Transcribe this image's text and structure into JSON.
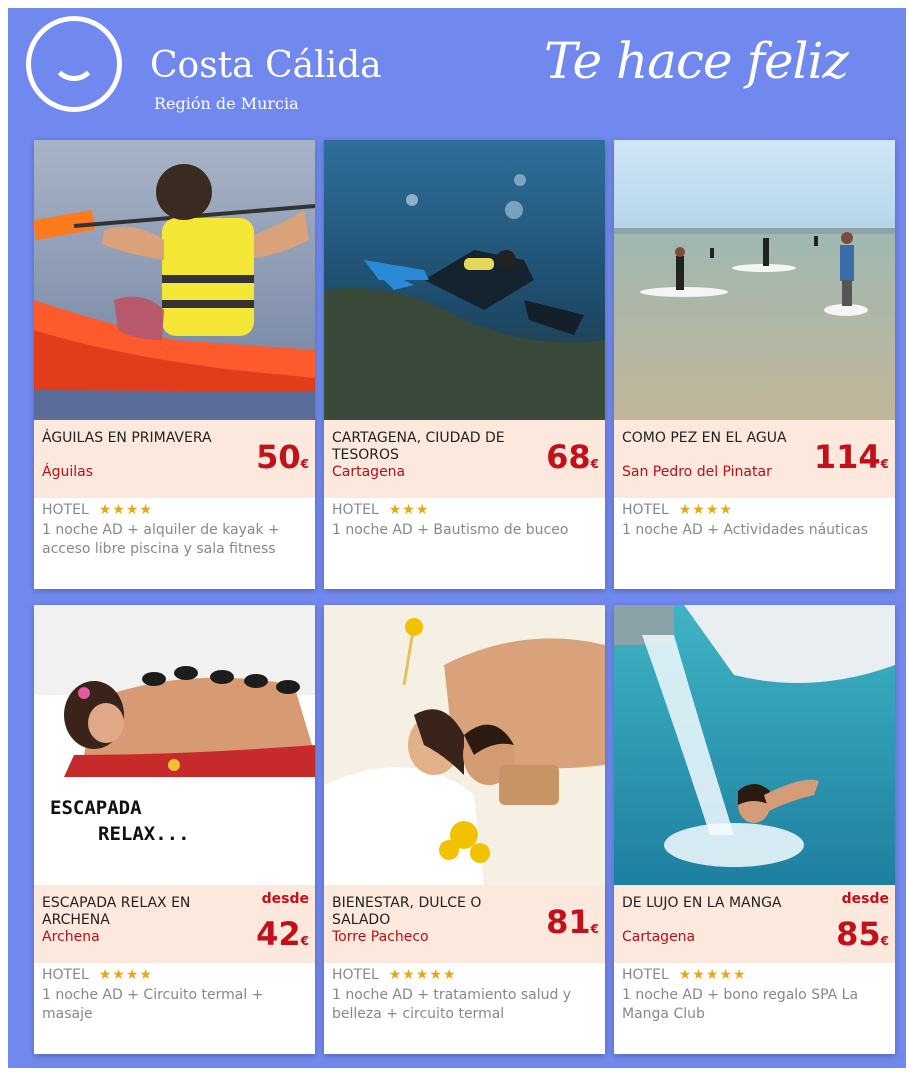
{
  "header": {
    "brand_title": "Costa Cálida",
    "brand_subtitle": "Región de Murcia",
    "slogan": "Te hace feliz"
  },
  "colors": {
    "background": "#7189ee",
    "price": "#c1121b",
    "info_bg": "#fce8dc",
    "star": "#e6a817"
  },
  "offers": [
    {
      "title": "ÁGUILAS EN PRIMAVERA",
      "city": "Águilas",
      "price": "50",
      "currency": "€",
      "desde": "",
      "hotel": "HOTEL",
      "stars": "★★★★",
      "description": "1 noche AD + alquiler de kayak + acceso libre piscina y sala fitness",
      "image": "kayak-photo"
    },
    {
      "title": "CARTAGENA, CIUDAD DE TESOROS",
      "city": "Cartagena",
      "price": "68",
      "currency": "€",
      "desde": "",
      "hotel": "HOTEL",
      "stars": "★★★",
      "description": "1 noche AD + Bautismo de buceo",
      "image": "diving-photo"
    },
    {
      "title": "COMO PEZ EN EL AGUA",
      "city": "San Pedro del Pinatar",
      "price": "114",
      "currency": "€",
      "desde": "",
      "hotel": "HOTEL",
      "stars": "★★★★",
      "description": "1 noche AD + Actividades náuticas",
      "image": "paddle-surf-photo"
    },
    {
      "title": "ESCAPADA RELAX EN ARCHENA",
      "city": "Archena",
      "price": "42",
      "currency": "€",
      "desde": "desde",
      "hotel": "HOTEL",
      "stars": "★★★★",
      "description": "1 noche AD + Circuito termal + masaje",
      "image": "hot-stone-massage-photo",
      "image_text": [
        "ESCAPADA",
        "RELAX..."
      ]
    },
    {
      "title": "BIENESTAR, DULCE O SALADO",
      "city": "Torre Pacheco",
      "price": "81",
      "currency": "€",
      "desde": "",
      "hotel": "HOTEL",
      "stars": "★★★★★",
      "description": "1 noche AD + tratamiento salud y belleza + circuito termal",
      "image": "spa-couple-photo"
    },
    {
      "title": "DE LUJO EN LA MANGA",
      "city": "Cartagena",
      "price": "85",
      "currency": "€",
      "desde": "desde",
      "hotel": "HOTEL",
      "stars": "★★★★★",
      "description": "1 noche AD + bono regalo SPA La Manga Club",
      "image": "spa-waterfall-photo"
    }
  ]
}
